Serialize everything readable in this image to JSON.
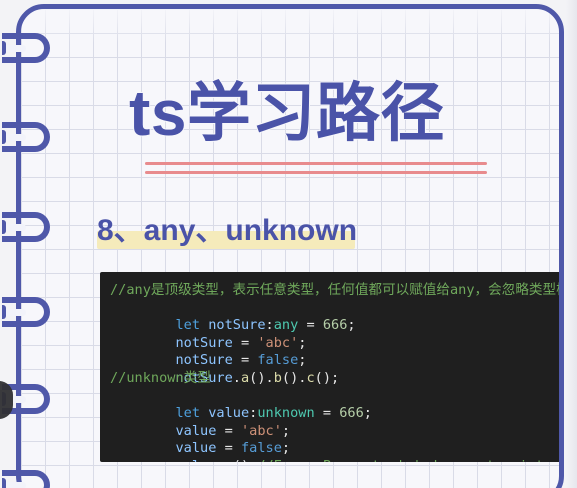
{
  "page": {
    "title": "ts学习路径",
    "section_title": "8、any、unknown"
  },
  "code": {
    "lines": [
      "//any是顶级类型，表示任意类型，任何值都可以赋值给any，会忽略类型检查",
      "let notSure:any = 666;",
      "notSure = 'abc';",
      "notSure = false;",
      "notSure.a().b().c();",
      "//unknown类型",
      "let value:unknown = 666;",
      "value = 'abc';",
      "value = false;",
      "value.a() //Error Property 'a' does not exist on type 'unknown'"
    ]
  },
  "colors": {
    "accent": "#4f58a9",
    "underline": "#e88b8d",
    "highlight": "#f5ebbb",
    "code_background": "#1f1f1f",
    "comment": "#6fa85b",
    "keyword": "#4ea0dd",
    "type": "#4ec9b0",
    "string": "#ce9178",
    "bool": "#569cd6",
    "number": "#b5cea8"
  },
  "icons": {
    "spiral_rings": "spiral-binding-icon"
  }
}
